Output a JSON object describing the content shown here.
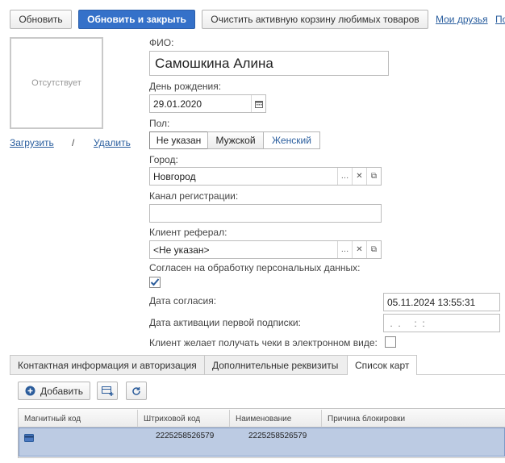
{
  "toolbar": {
    "refresh": "Обновить",
    "refresh_close": "Обновить и закрыть",
    "clear_basket": "Очистить активную корзину любимых товаров",
    "my_friends": "Мои друзья",
    "cut_link": "По"
  },
  "photo": {
    "placeholder": "Отсутствует",
    "upload": "Загрузить",
    "separator": "/",
    "delete": "Удалить"
  },
  "form": {
    "fio_label": "ФИО:",
    "fio_value": "Самошкина Алина",
    "birthday_label": "День рождения:",
    "birthday_value": "29.01.2020",
    "gender_label": "Пол:",
    "gender_options": [
      "Не указан",
      "Мужской",
      "Женский"
    ],
    "gender_selected": "Не указан",
    "city_label": "Город:",
    "city_value": "Новгород",
    "channel_label": "Канал регистрации:",
    "channel_value": "",
    "referral_label": "Клиент реферал:",
    "referral_value": "<Не указан>",
    "consent_label": "Согласен на обработку персональных данных:",
    "consent_checked": true,
    "consent_date_label": "Дата согласия:",
    "consent_date_value": "05.11.2024 13:55:31",
    "sub_date_label": "Дата активации первой подписки:",
    "sub_date_value": " .  .     :  :",
    "e_receipt_label": "Клиент желает получать чеки в электронном виде:",
    "e_receipt_checked": false
  },
  "tabs": [
    "Контактная информация и авторизация",
    "Дополнительные реквизиты",
    "Список карт"
  ],
  "active_tab": "Список карт",
  "cards": {
    "add_label": "Добавить",
    "columns": [
      "Магнитный код",
      "Штриховой код",
      "Наименование",
      "Причина блокировки"
    ],
    "rows": [
      {
        "magnetic": "",
        "barcode": "2225258526579",
        "name": "2225258526579",
        "reason": ""
      }
    ]
  },
  "colors": {
    "primary": "#3571c9",
    "link": "#2a5e9e",
    "selected_row": "#bccbe3"
  }
}
